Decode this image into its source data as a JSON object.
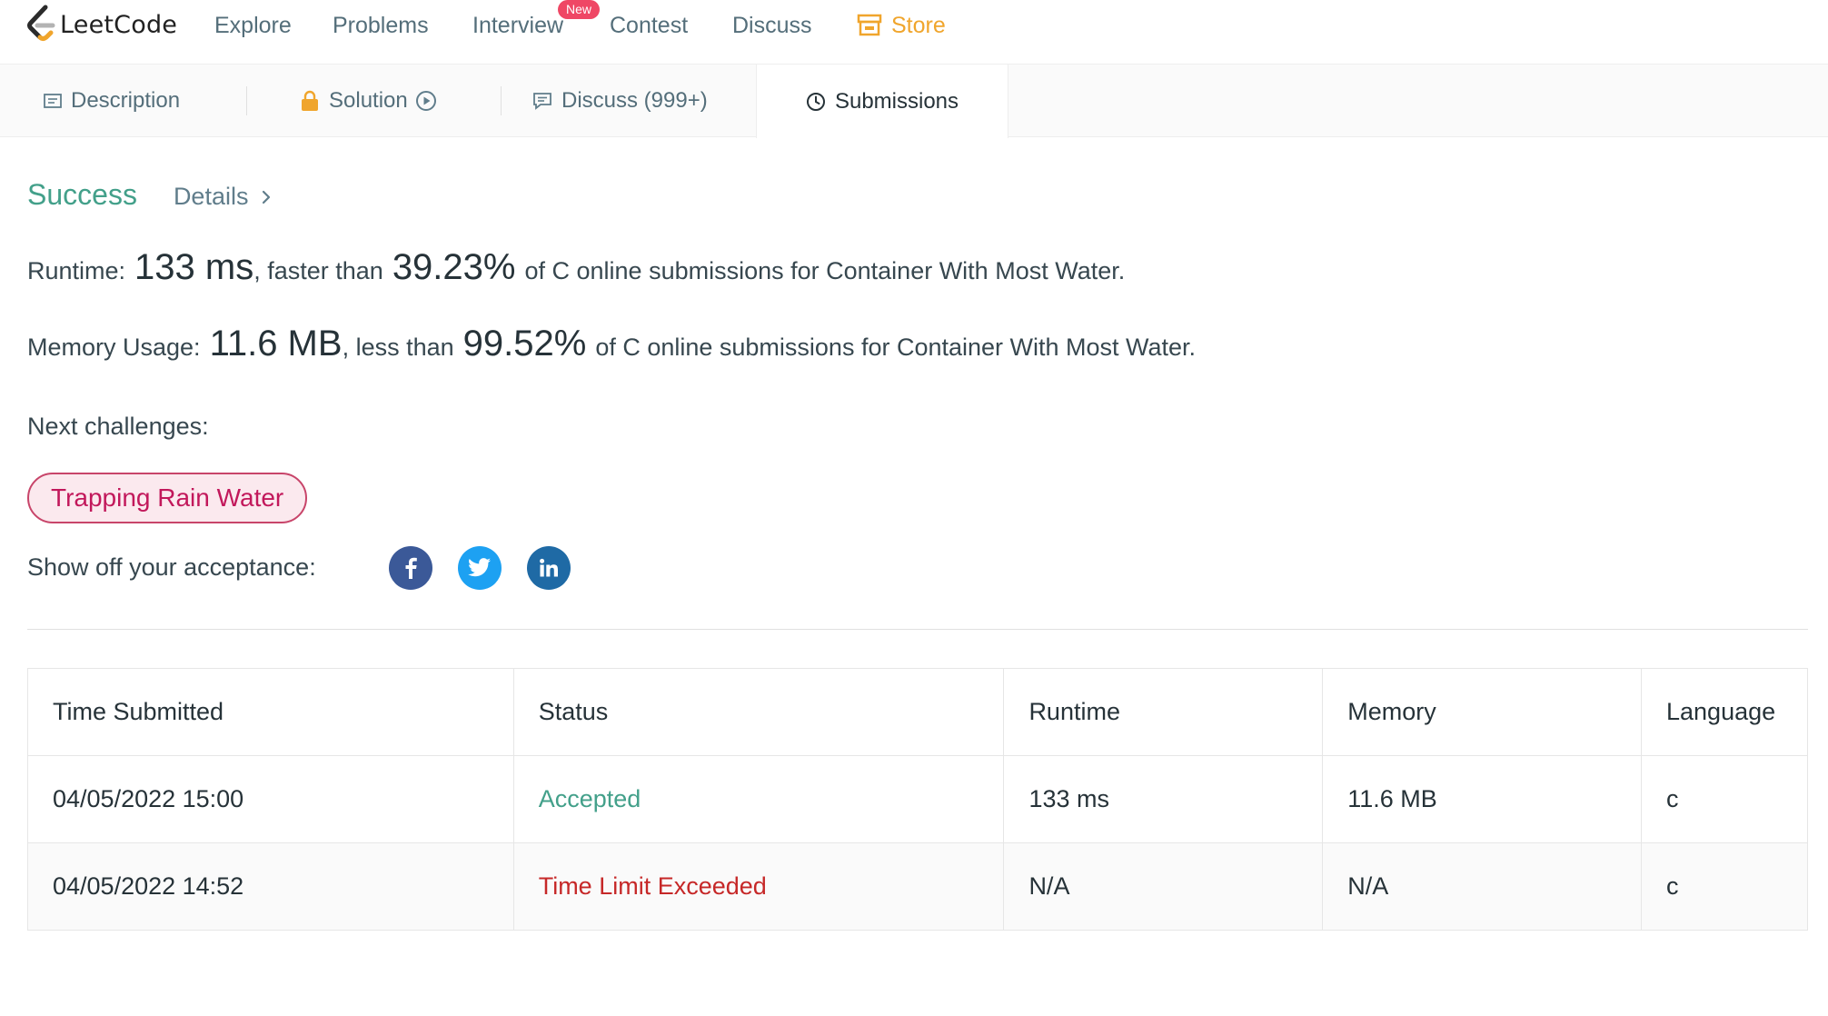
{
  "nav": {
    "brand": "LeetCode",
    "items": [
      "Explore",
      "Problems",
      "Interview",
      "Contest",
      "Discuss"
    ],
    "new_badge": "New",
    "store": "Store",
    "store_color": "#f0a52c"
  },
  "tabs": {
    "description": "Description",
    "solution": "Solution",
    "discuss": "Discuss (999+)",
    "submissions": "Submissions"
  },
  "result": {
    "status": "Success",
    "details": "Details",
    "runtime_label": "Runtime:",
    "runtime_value": "133 ms",
    "runtime_mid": ", faster than",
    "runtime_percent": "39.23%",
    "runtime_tail": "of C online submissions for Container With Most Water.",
    "memory_label": "Memory Usage:",
    "memory_value": "11.6 MB",
    "memory_mid": ", less than",
    "memory_percent": "99.52%",
    "memory_tail": "of C online submissions for Container With Most Water.",
    "status_color": "#43a08a"
  },
  "next": {
    "label": "Next challenges:",
    "challenges": [
      "Trapping Rain Water"
    ]
  },
  "share": {
    "label": "Show off your acceptance:",
    "icons": [
      "facebook-icon",
      "twitter-icon",
      "linkedin-icon"
    ]
  },
  "submissions_table": {
    "headers": [
      "Time Submitted",
      "Status",
      "Runtime",
      "Memory",
      "Language"
    ],
    "rows": [
      [
        "04/05/2022 15:00",
        "Accepted",
        "133 ms",
        "11.6 MB",
        "c"
      ],
      [
        "04/05/2022 14:52",
        "Time Limit Exceeded",
        "N/A",
        "N/A",
        "c"
      ]
    ]
  }
}
